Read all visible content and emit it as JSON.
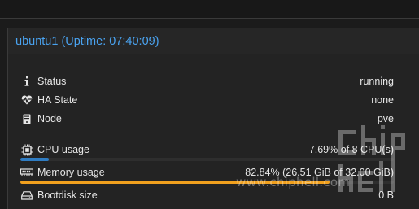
{
  "panel": {
    "title": "ubuntu1 (Uptime: 07:40:09)"
  },
  "rows": {
    "status": {
      "label": "Status",
      "value": "running",
      "icon": "info-icon"
    },
    "ha_state": {
      "label": "HA State",
      "value": "none",
      "icon": "heartbeat-icon"
    },
    "node": {
      "label": "Node",
      "value": "pve",
      "icon": "server-icon"
    },
    "cpu": {
      "label": "CPU usage",
      "value": "7.69% of 8 CPU(s)",
      "icon": "cpu-icon",
      "fraction": 0.0769,
      "color": "#2f7cc2"
    },
    "memory": {
      "label": "Memory usage",
      "value": "82.84% (26.51 GiB of 32.00 GiB)",
      "icon": "memory-icon",
      "fraction": 0.8284,
      "color": "#f0a01e"
    },
    "bootdisk": {
      "label": "Bootdisk size",
      "value": "0 B",
      "icon": "disk-icon"
    }
  },
  "watermark": {
    "url": "www.chiphell.com",
    "logo_text": "chip hell"
  }
}
